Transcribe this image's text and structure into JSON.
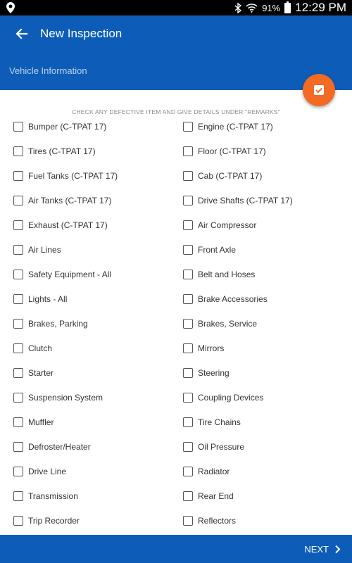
{
  "status_bar": {
    "battery_percent": "91%",
    "time": "12:29 PM",
    "icons": [
      "location-icon",
      "bluetooth-icon",
      "wifi-icon",
      "battery-icon"
    ]
  },
  "app_bar": {
    "title": "New Inspection",
    "subtitle": "Vehicle Information",
    "back_icon": "arrow-back-icon",
    "color": "#0d5db8"
  },
  "fab": {
    "icon": "checkbox-icon",
    "color": "#f26a24"
  },
  "instructions": "CHECK ANY DEFECTIVE ITEM AND GIVE DETAILS UNDER \"REMARKS\"",
  "items_left": [
    {
      "label": "Bumper (C-TPAT 17)",
      "checked": false
    },
    {
      "label": "Tires (C-TPAT 17)",
      "checked": false
    },
    {
      "label": "Fuel Tanks (C-TPAT 17)",
      "checked": false
    },
    {
      "label": "Air Tanks (C-TPAT 17)",
      "checked": false
    },
    {
      "label": "Exhaust (C-TPAT 17)",
      "checked": false
    },
    {
      "label": "Air Lines",
      "checked": false
    },
    {
      "label": "Safety Equipment - All",
      "checked": false
    },
    {
      "label": "Lights - All",
      "checked": false
    },
    {
      "label": "Brakes, Parking",
      "checked": false
    },
    {
      "label": "Clutch",
      "checked": false
    },
    {
      "label": "Starter",
      "checked": false
    },
    {
      "label": "Suspension System",
      "checked": false
    },
    {
      "label": "Muffler",
      "checked": false
    },
    {
      "label": "Defroster/Heater",
      "checked": false
    },
    {
      "label": "Drive Line",
      "checked": false
    },
    {
      "label": "Transmission",
      "checked": false
    },
    {
      "label": "Trip Recorder",
      "checked": false
    }
  ],
  "items_right": [
    {
      "label": "Engine (C-TPAT 17)",
      "checked": false
    },
    {
      "label": "Floor (C-TPAT 17)",
      "checked": false
    },
    {
      "label": "Cab (C-TPAT 17)",
      "checked": false
    },
    {
      "label": "Drive Shafts (C-TPAT 17)",
      "checked": false
    },
    {
      "label": "Air Compressor",
      "checked": false
    },
    {
      "label": "Front Axle",
      "checked": false
    },
    {
      "label": "Belt and Hoses",
      "checked": false
    },
    {
      "label": "Brake Accessories",
      "checked": false
    },
    {
      "label": "Brakes, Service",
      "checked": false
    },
    {
      "label": "Mirrors",
      "checked": false
    },
    {
      "label": "Steering",
      "checked": false
    },
    {
      "label": "Coupling Devices",
      "checked": false
    },
    {
      "label": "Tire Chains",
      "checked": false
    },
    {
      "label": "Oil Pressure",
      "checked": false
    },
    {
      "label": "Radiator",
      "checked": false
    },
    {
      "label": "Rear End",
      "checked": false
    },
    {
      "label": "Reflectors",
      "checked": false
    }
  ],
  "bottom_bar": {
    "next_label": "NEXT",
    "next_icon": "chevron-right-icon"
  }
}
